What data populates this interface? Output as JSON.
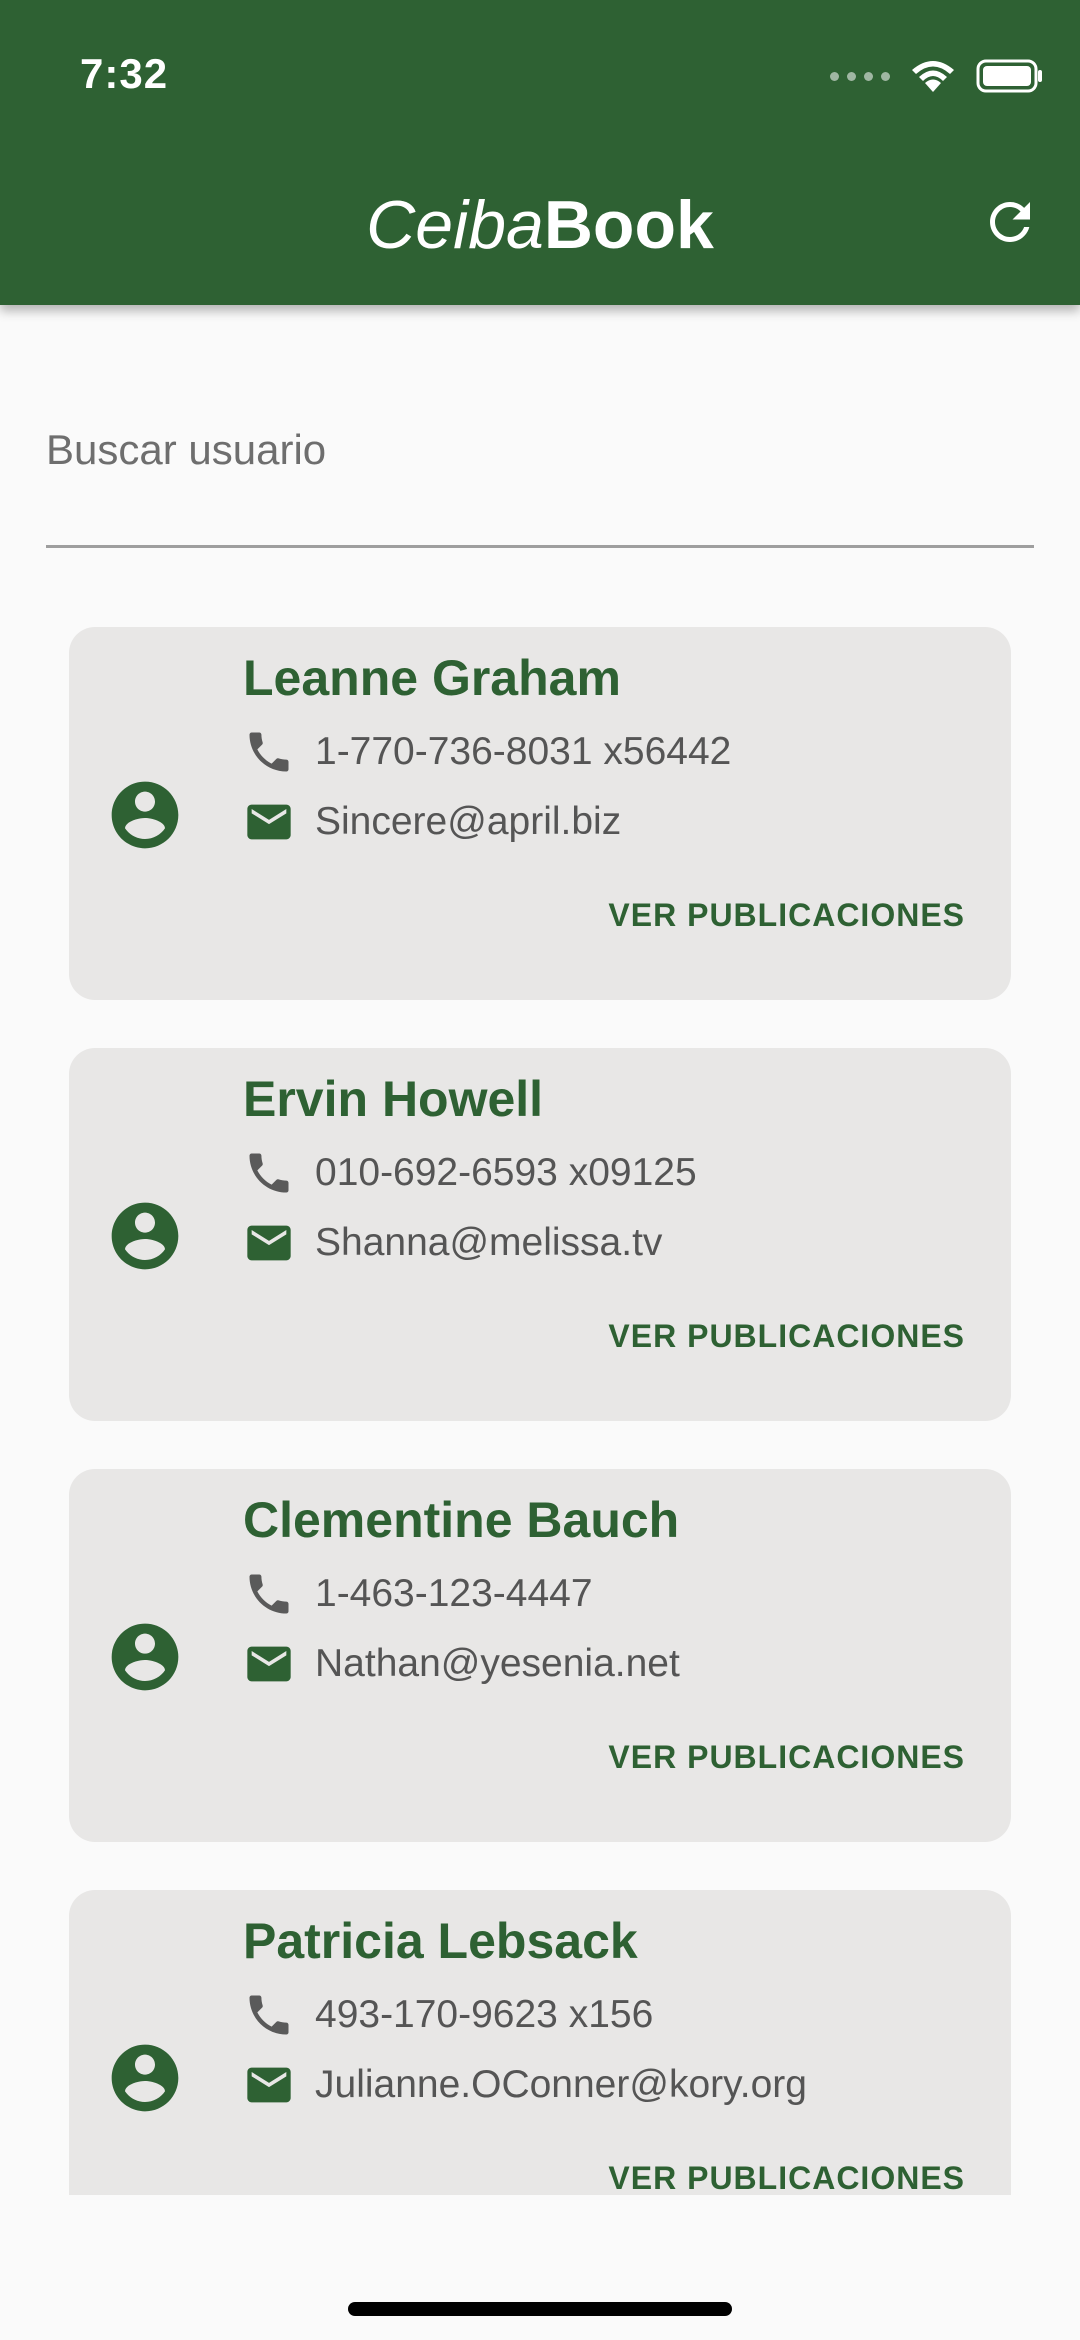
{
  "status_bar": {
    "time": "7:32"
  },
  "app_bar": {
    "title_italic": "Ceiba",
    "title_bold": "Book",
    "refresh_icon": "refresh-icon"
  },
  "search": {
    "placeholder": "Buscar usuario",
    "value": ""
  },
  "colors": {
    "primary": "#2e6133",
    "card": "#e8e7e6",
    "text_muted": "#555555"
  },
  "users": [
    {
      "name": "Leanne Graham",
      "phone": "1-770-736-8031 x56442",
      "email": "Sincere@april.biz",
      "action": "VER PUBLICACIONES"
    },
    {
      "name": "Ervin Howell",
      "phone": "010-692-6593 x09125",
      "email": "Shanna@melissa.tv",
      "action": "VER PUBLICACIONES"
    },
    {
      "name": "Clementine Bauch",
      "phone": "1-463-123-4447",
      "email": "Nathan@yesenia.net",
      "action": "VER PUBLICACIONES"
    },
    {
      "name": "Patricia Lebsack",
      "phone": "493-170-9623 x156",
      "email": "Julianne.OConner@kory.org",
      "action": "VER PUBLICACIONES"
    }
  ]
}
